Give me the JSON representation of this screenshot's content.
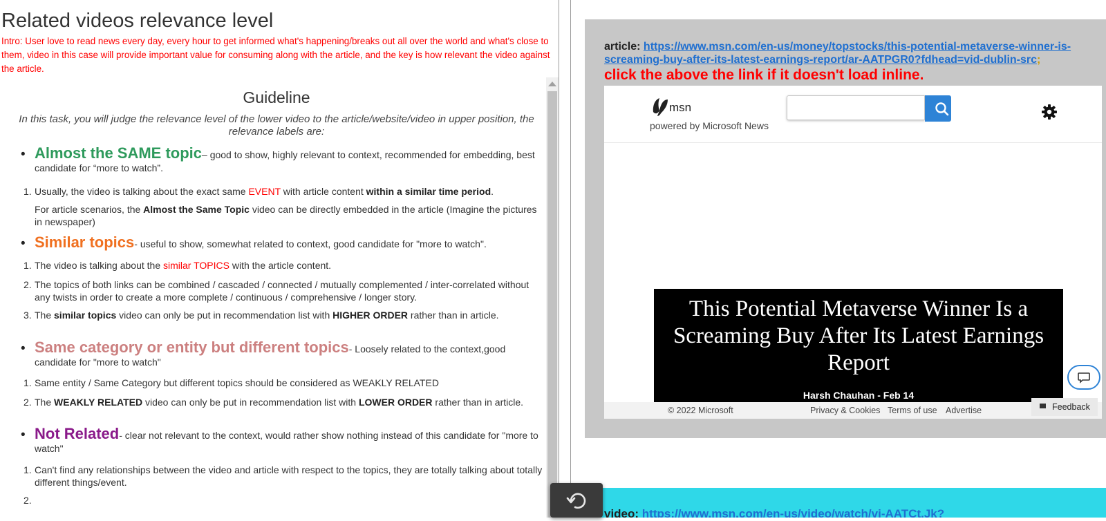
{
  "left": {
    "title": "Related videos relevance level",
    "intro": "Intro: User love to read news every day, every hour to get informed what's happening/breaks out all over the world and what's close to them, video in this case will provide important value for consuming along with the article, and the key is how relevant the video against the article.",
    "guideline_title": "Guideline",
    "guideline_desc": "In this task, you will judge the relevance level of the lower video to the article/website/video in upper position, the relevance labels are:",
    "levels": [
      {
        "name": "Almost the SAME topic",
        "color": "#2e9a5c",
        "desc": "– good to show, highly relevant to context, recommended for embedding, best candidate for “more to watch”.",
        "items": [
          {
            "num": "1.",
            "pre": "Usually, the video is talking about the exact same ",
            "red": "EVENT",
            "mid": " with article content ",
            "bold": "within a similar time period",
            "post": "."
          },
          {
            "num": "",
            "pre": "For article scenarios, the ",
            "bold": "Almost the Same Topic",
            "post": " video can be directly embedded in the article (Imagine the pictures in newspaper)"
          }
        ]
      },
      {
        "name": "Similar topics",
        "color": "#f07020",
        "desc": "- useful to show, somewhat related to context, good candidate for \"more to watch\".",
        "items": [
          {
            "num": "1.",
            "pre": "The video is talking about the ",
            "red": "similar TOPICS",
            "post": " with the article content."
          },
          {
            "num": "2.",
            "pre": "The topics of both links can be combined / cascaded / connected / mutually complemented / inter-correlated without any twists in order to create a more complete / continuous / comprehensive / longer story."
          },
          {
            "num": "3.",
            "pre": "The ",
            "bold": "similar topics",
            "mid": " video can only be put in recommendation list with ",
            "bold2": "HIGHER ORDER",
            "post": " rather than in article."
          }
        ]
      },
      {
        "name": "Same category or entity but different topics",
        "color": "#cc8080",
        "desc": "- Loosely related to the context,good candidate for \"more to watch\"",
        "items": [
          {
            "num": "1.",
            "pre": "Same entity / Same Category but different topics should be considered as WEAKLY RELATED"
          },
          {
            "num": "2.",
            "pre": "The ",
            "bold": "WEAKLY RELATED",
            "mid": " video can only be put in recommendation list with ",
            "bold2": "LOWER ORDER",
            "post": " rather than in article."
          }
        ]
      },
      {
        "name": "Not Related",
        "color": "#8a1a8a",
        "desc": "- clear not relevant to the context, would rather show nothing instead of this candidate for \"more to watch\"",
        "items": [
          {
            "num": "1.",
            "pre": "Can't find any relationships between the video and article with respect to the topics, they are totally talking about totally different things/event."
          },
          {
            "num": "2.",
            "pre": ""
          }
        ]
      }
    ]
  },
  "right": {
    "article_label": "article:",
    "article_url": "https://www.msn.com/en-us/money/topstocks/this-potential-metaverse-winner-is-screaming-buy-after-its-latest-earnings-report/ar-AATPGR0?fdhead=vid-dublin-src",
    "article_url_line1": "https://www.msn.com/en-us/money/topstocks/this-potential-metaverse-winner-is-",
    "article_url_line2": "screaming-buy-after-its-latest-earnings-report/ar-AATPGR0?fdhead=vid-dublin-src",
    "semicolon": ";",
    "click_note": "click the above the link if it doesn't load inline.",
    "msn": {
      "brand": "msn",
      "powered_by": "powered by Microsoft News",
      "search_placeholder": "",
      "headline": "This Potential Metaverse Winner Is a Screaming Buy After Its Latest Earnings Report",
      "byline": "Harsh Chauhan - Feb 14",
      "footer": {
        "copyright": "© 2022 Microsoft",
        "privacy": "Privacy & Cookies",
        "terms": "Terms of use",
        "advertise": "Advertise",
        "feedback": "Feedback"
      }
    },
    "video_label": "video:",
    "video_url": "https://www.msn.com/en-us/video/watch/vi-AATCt.Jk?"
  },
  "icons": {
    "search": "search-icon",
    "gear": "gear-icon",
    "chat": "chat-bubble-icon",
    "reload": "reload-icon",
    "msn_logo": "msn-butterfly-icon"
  },
  "colors": {
    "intro_red": "#ff0000",
    "link_blue": "#1f6fd0",
    "msn_blue": "#2e83d6",
    "video_strip": "#2fd8e8",
    "frame_gray": "#c7c7c7"
  }
}
